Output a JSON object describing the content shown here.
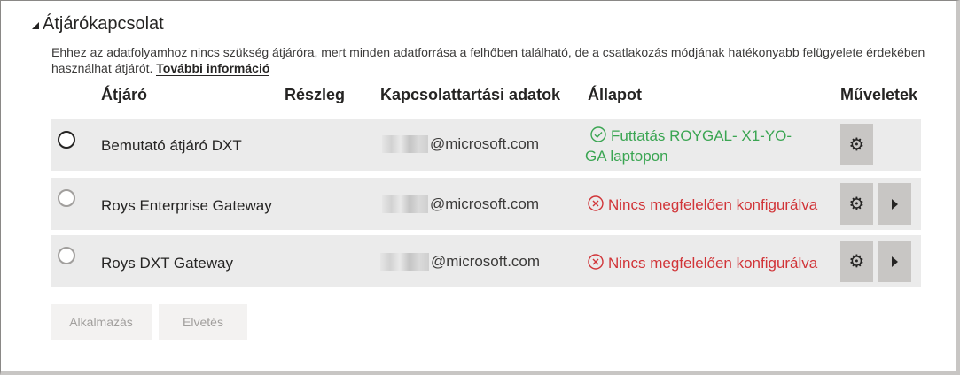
{
  "section": {
    "title": "Átjárókapcsolat",
    "description": "Ehhez az adatfolyamhoz nincs szükség átjáróra, mert minden adatforrása a felhőben található, de a csatlakozás módjának hatékonyabb felügyelete érdekében használhat átjárót.",
    "more_link": "További információ"
  },
  "table": {
    "headers": {
      "gateway": "Átjáró",
      "department": "Részleg",
      "contact": "Kapcsolattartási adatok",
      "status": "Állapot",
      "actions": "Műveletek"
    },
    "rows": [
      {
        "name": "Bemutató átjáró DXT",
        "department": "",
        "contact": "@microsoft.com",
        "status": "Futtatás ROYGAL- X1-YO-GA laptopon",
        "status_line1": "Futtatás ROYGAL- X1-YO-",
        "status_line2": "GA laptopon",
        "status_type": "ok",
        "selected": true
      },
      {
        "name": "Roys Enterprise Gateway",
        "department": "",
        "contact": "@microsoft.com",
        "status": "Nincs megfelelően konfigurálva",
        "status_type": "error",
        "selected": false
      },
      {
        "name": "Roys DXT Gateway",
        "department": "",
        "contact": "@microsoft.com",
        "status": "Nincs megfelelően konfigurálva",
        "status_type": "error",
        "selected": false
      }
    ]
  },
  "buttons": {
    "apply": "Alkalmazás",
    "discard": "Elvetés"
  },
  "colors": {
    "ok": "#3aa552",
    "error": "#d13438",
    "row_bg": "#ebebeb",
    "action_bg": "#c8c6c4"
  },
  "icons": {
    "collapse": "triangle-collapse-icon",
    "ok_status": "check-circle-icon",
    "error_status": "x-circle-icon",
    "settings": "gear-icon",
    "expand": "chevron-right-icon"
  }
}
